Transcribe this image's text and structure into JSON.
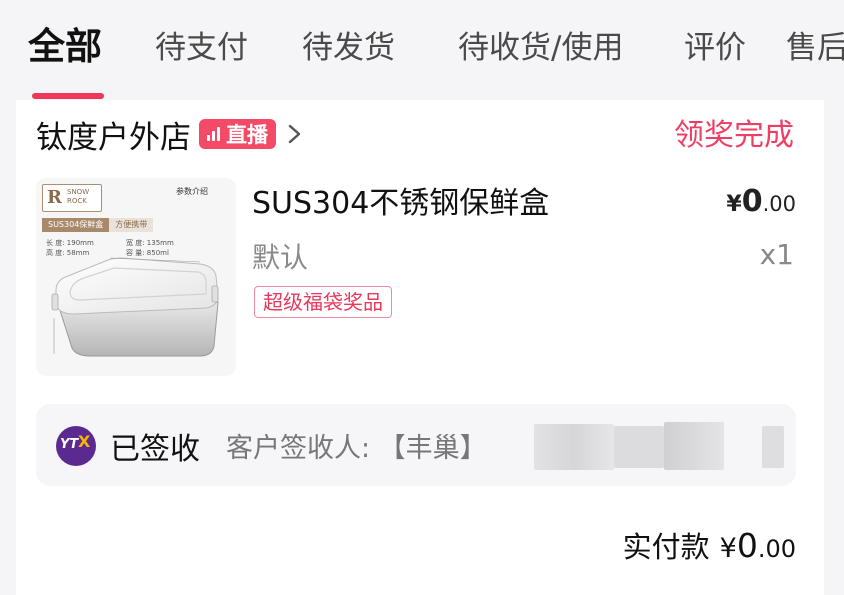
{
  "tabs": [
    {
      "label": "全部",
      "active": true
    },
    {
      "label": "待支付",
      "active": false
    },
    {
      "label": "待发货",
      "active": false
    },
    {
      "label": "待收货/使用",
      "active": false
    },
    {
      "label": "评价",
      "active": false
    },
    {
      "label": "售后",
      "active": false
    }
  ],
  "order": {
    "shop_name": "钛度户外店",
    "live_badge": "直播",
    "status": "领奖完成",
    "product": {
      "image_brand": "SNOW ROCK",
      "image_params_title": "参数介绍",
      "image_tag_a": "SUS304保鲜盒",
      "image_tag_b": "方便携带",
      "image_specs": [
        "长 度: 190mm",
        "宽 度: 135mm",
        "高 度: 58mm",
        "容 量: 850ml"
      ],
      "name": "SUS304不锈钢保鲜盒",
      "spec": "默认",
      "tag": "超级福袋奖品",
      "price_currency": "¥",
      "price_int": "0",
      "price_dec": ".00",
      "quantity": "x1"
    },
    "logistics": {
      "courier_logo_text": "YT",
      "status": "已签收",
      "detail": "客户签收人: 【丰巢】"
    },
    "total": {
      "label": "实付款",
      "currency": "¥",
      "amount_int": "0",
      "amount_dec": ".00"
    }
  },
  "colors": {
    "accent": "#f0365a",
    "status": "#ef3e63",
    "courier": "#5a2a91"
  }
}
